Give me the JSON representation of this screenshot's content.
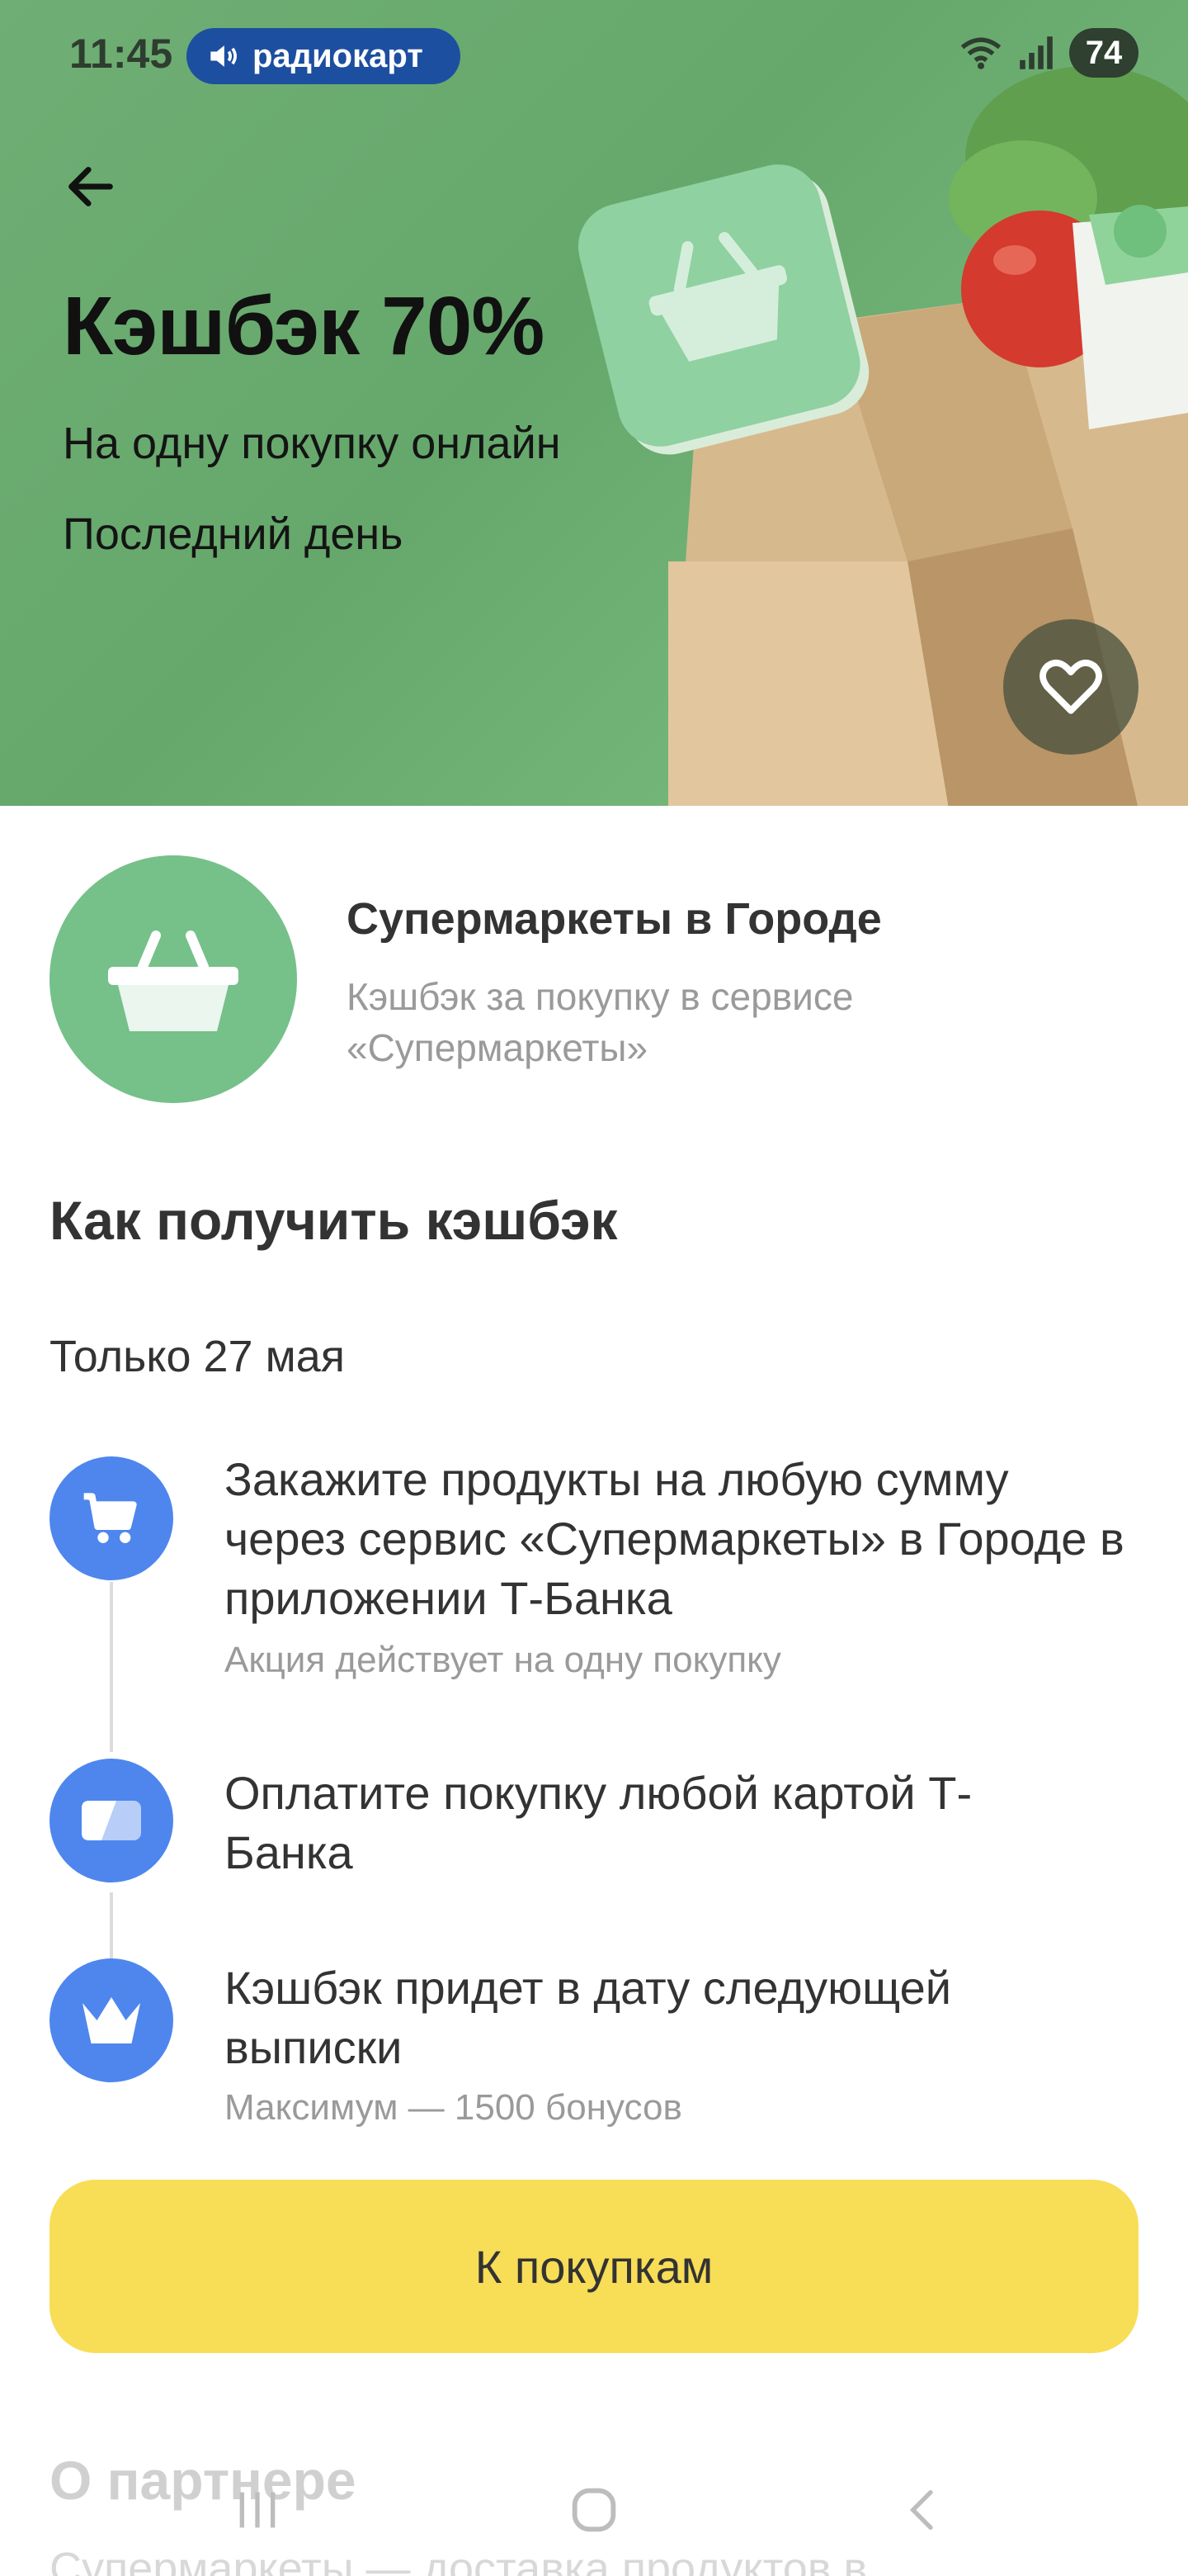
{
  "status_bar": {
    "time": "11:45",
    "media_pill": "радиокарт",
    "battery": "74"
  },
  "hero": {
    "title": "Кэшбэк 70%",
    "subtitle": "На одну покупку онлайн",
    "deadline": "Последний день",
    "accent_color": "#6fae74"
  },
  "partner": {
    "name": "Супермаркеты в Городе",
    "description": "Кэшбэк за покупку в сервисе «Супермаркеты»"
  },
  "how_to": {
    "title": "Как получить кэшбэк",
    "date_note": "Только 27 мая",
    "steps": [
      {
        "icon": "cart-icon",
        "text": "Закажите продукты на любую сумму через сервис «Супермаркеты» в Городе в приложении Т-Банка",
        "note": "Акция действует на одну покупку"
      },
      {
        "icon": "card-icon",
        "text": "Оплатите покупку любой картой Т-Банка",
        "note": ""
      },
      {
        "icon": "crown-icon",
        "text": "Кэшбэк придет в дату следующей выписки",
        "note": "Максимум — 1500 бонусов"
      }
    ]
  },
  "cta": {
    "label": "К покупкам",
    "color": "#f8dd56"
  },
  "about": {
    "title": "О партнере",
    "text": "Супермаркеты — доставка продуктов в"
  },
  "step_icon_color": "#4e86ee"
}
